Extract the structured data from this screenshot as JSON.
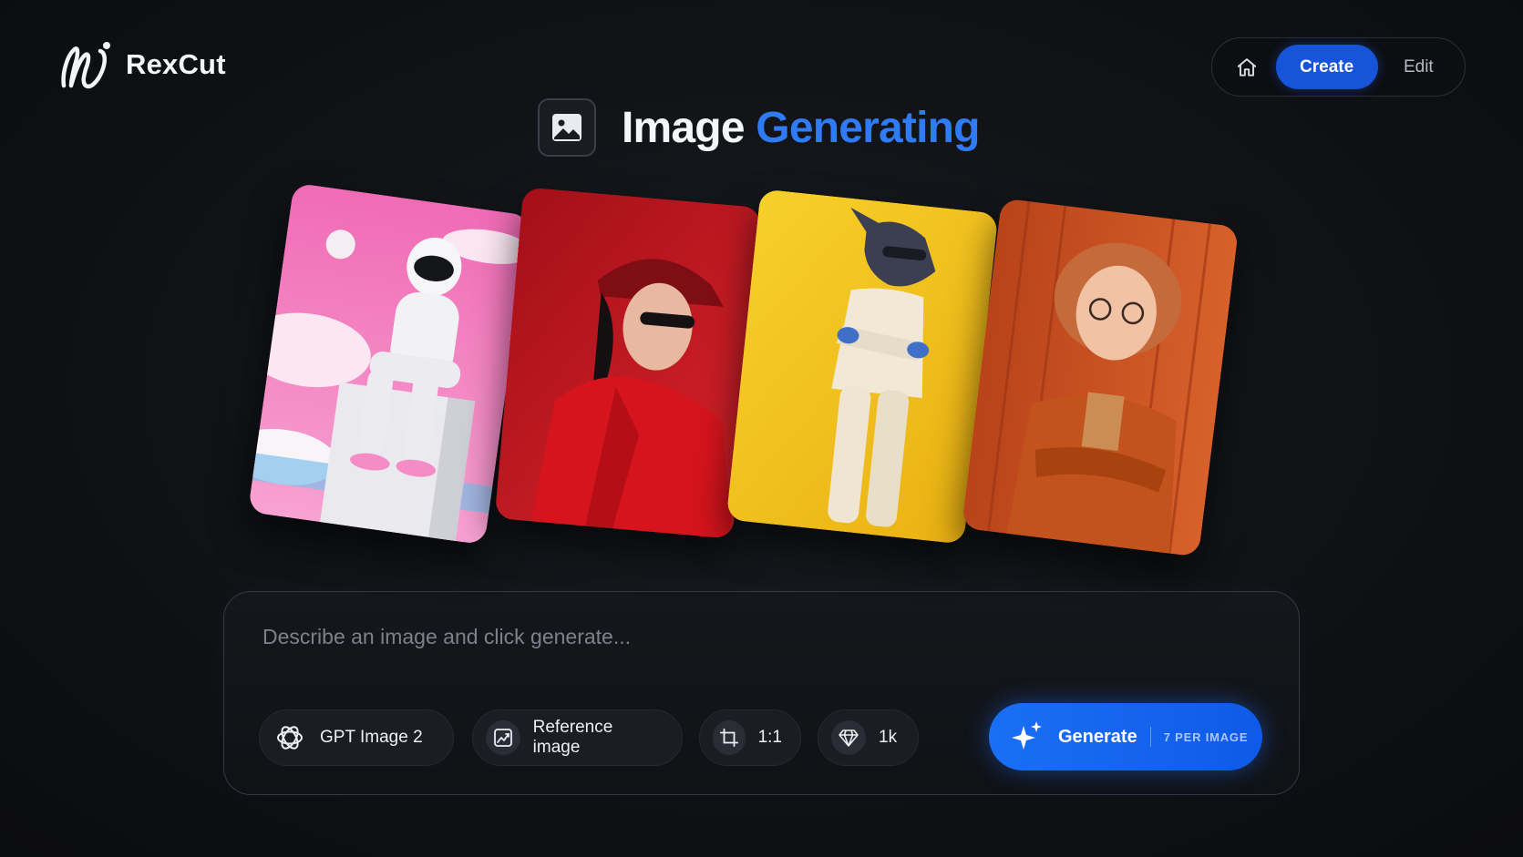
{
  "app": {
    "name": "RexCut",
    "brand_color": "#1654d9",
    "accent_color": "#2f7bf5"
  },
  "nav": {
    "items": [
      {
        "icon": "home-icon",
        "label": ""
      },
      {
        "label": "Create",
        "active": true
      },
      {
        "label": "Edit",
        "active": false
      }
    ]
  },
  "header": {
    "title_main": "Image",
    "title_accent": "Generating",
    "icon": "image-icon"
  },
  "gallery": {
    "cards": [
      {
        "subject": "astronaut-sitting",
        "background": "#f47fbf"
      },
      {
        "subject": "woman-red-cap",
        "background": "#b3151d"
      },
      {
        "subject": "fox-white-suit",
        "background": "#f2c21e"
      },
      {
        "subject": "girl-glasses",
        "background": "#c8501a"
      }
    ]
  },
  "prompt": {
    "placeholder": "Describe an image and click generate...",
    "value": ""
  },
  "options": {
    "model": {
      "label": "GPT Image 2",
      "icon": "openai-icon"
    },
    "reference": {
      "label": "Reference image",
      "icon": "image-chart-icon"
    },
    "aspect_ratio": {
      "label": "1:1",
      "icon": "crop-icon"
    },
    "resolution": {
      "label": "1k",
      "icon": "diamond-icon"
    }
  },
  "generate": {
    "label": "Generate",
    "cost": "7 PER IMAGE",
    "icon": "sparkle-icon"
  }
}
